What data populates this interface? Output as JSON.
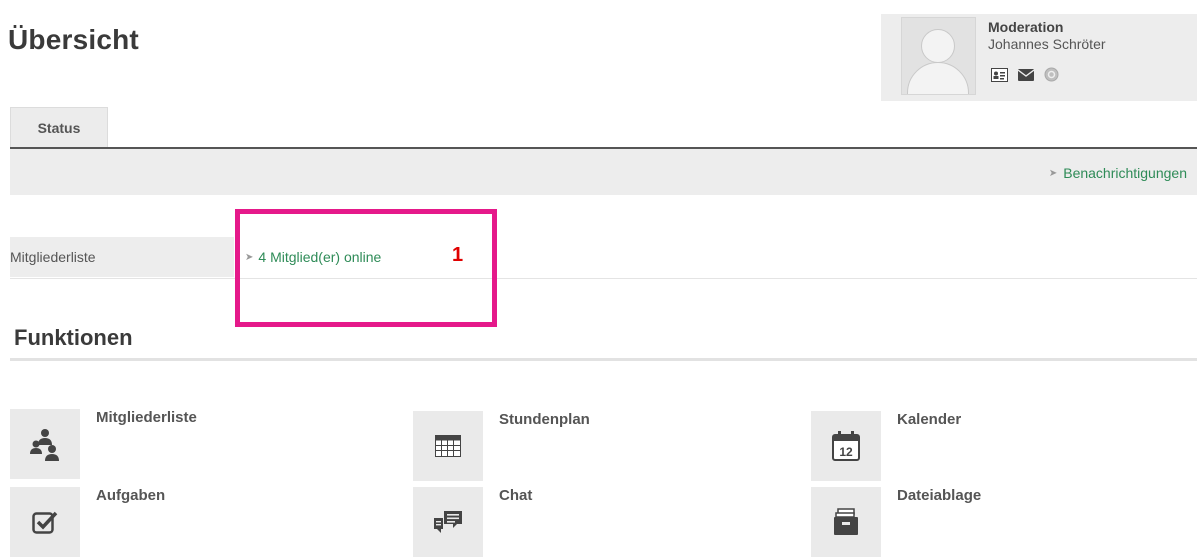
{
  "page": {
    "title": "Übersicht"
  },
  "profile": {
    "role": "Moderation",
    "name": "Johannes Schröter",
    "icons": [
      "contact-card-icon",
      "mail-icon",
      "status-icon"
    ]
  },
  "tabs": [
    {
      "label": "Status"
    }
  ],
  "status": {
    "notifications_label": "Benachrichtigungen"
  },
  "members_row": {
    "label": "Mitgliederliste",
    "online_label": "4 Mitglied(er) online"
  },
  "annotation": {
    "number": "1",
    "color": "#e5198a",
    "number_color": "#e00000"
  },
  "functions": {
    "title": "Funktionen",
    "items": [
      {
        "label": "Mitgliederliste",
        "icon": "members-icon"
      },
      {
        "label": "Stundenplan",
        "icon": "timetable-icon"
      },
      {
        "label": "Kalender",
        "icon": "calendar-icon",
        "icon_text": "12"
      },
      {
        "label": "Aufgaben",
        "icon": "tasks-icon"
      },
      {
        "label": "Chat",
        "icon": "chat-icon"
      },
      {
        "label": "Dateiablage",
        "icon": "file-storage-icon"
      }
    ]
  },
  "colors": {
    "link": "#2e8b57",
    "panel": "#ededed",
    "icon": "#444444"
  }
}
